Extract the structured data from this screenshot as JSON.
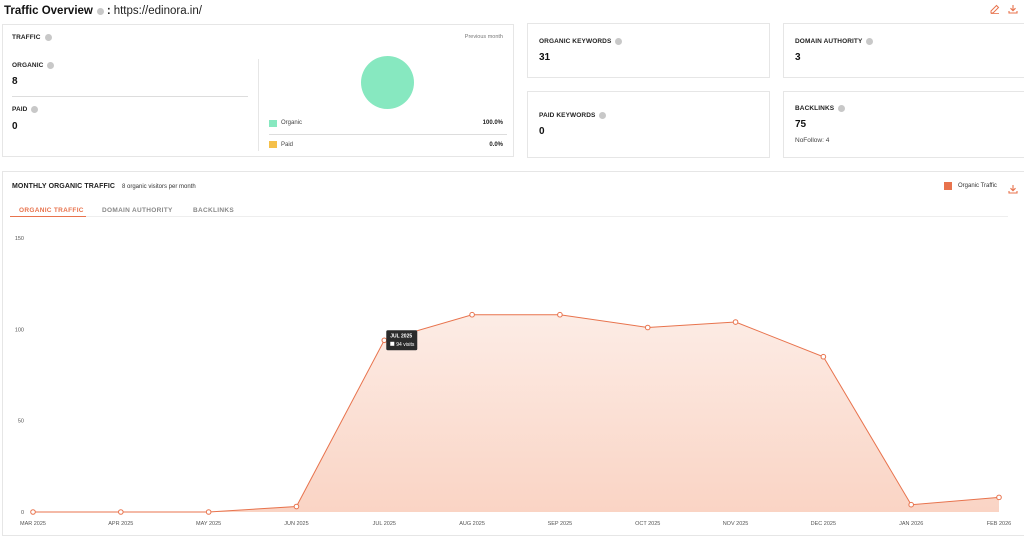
{
  "header": {
    "title": "Traffic Overview",
    "sep": ":",
    "url": "https://edinora.in/"
  },
  "traffic": {
    "label": "TRAFFIC",
    "period": "Previous month",
    "organic_label": "ORGANIC",
    "organic_value": "8",
    "paid_label": "PAID",
    "paid_value": "0",
    "legend": [
      {
        "name": "Organic",
        "pct": "100.0%",
        "color": "#87e8c0"
      },
      {
        "name": "Paid",
        "pct": "0.0%",
        "color": "#f5c04a"
      }
    ]
  },
  "metrics": {
    "organic_keywords_label": "ORGANIC KEYWORDS",
    "organic_keywords_value": "31",
    "domain_authority_label": "DOMAIN AUTHORITY",
    "domain_authority_value": "3",
    "paid_keywords_label": "PAID KEYWORDS",
    "paid_keywords_value": "0",
    "backlinks_label": "BACKLINKS",
    "backlinks_value": "75",
    "nofollow": "NoFollow: 4"
  },
  "monthly": {
    "title": "MONTHLY ORGANIC TRAFFIC",
    "subtitle": "8 organic visitors per month",
    "legend_label": "Organic Traffic",
    "tabs": [
      "ORGANIC TRAFFIC",
      "DOMAIN AUTHORITY",
      "BACKLINKS"
    ]
  },
  "colors": {
    "accent": "#e8734d",
    "organic": "#87e8c0",
    "paid": "#f5c04a"
  },
  "chart_data": {
    "type": "area",
    "categories": [
      "MAR 2025",
      "APR 2025",
      "MAY 2025",
      "JUN 2025",
      "JUL 2025",
      "AUG 2025",
      "SEP 2025",
      "OCT 2025",
      "NOV 2025",
      "DEC 2025",
      "JAN 2026",
      "FEB 2026"
    ],
    "series": [
      {
        "name": "Organic Traffic",
        "values": [
          0,
          0,
          0,
          3,
          94,
          108,
          108,
          101,
          104,
          85,
          4,
          8
        ]
      }
    ],
    "ylim": [
      0,
      150
    ],
    "yticks": [
      0,
      50,
      100,
      150
    ],
    "grid": false,
    "legend": "top-right",
    "tooltip": {
      "title": "JUL 2025",
      "text": "94 visits",
      "index": 4
    }
  }
}
